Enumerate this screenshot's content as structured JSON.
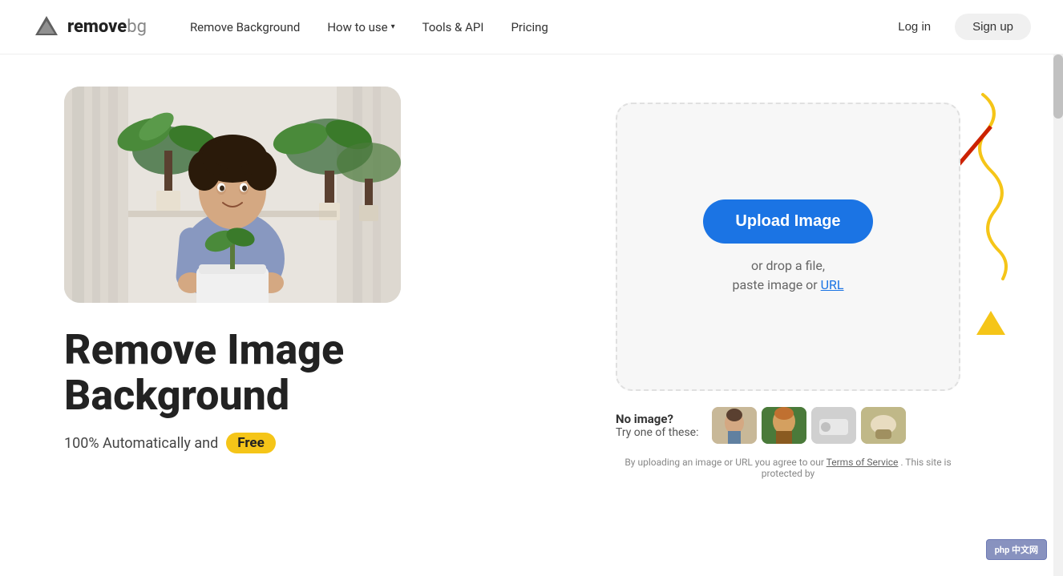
{
  "brand": {
    "logo_text_bold": "remove",
    "logo_text_light": "bg",
    "logo_alt": "remove.bg logo"
  },
  "nav": {
    "remove_bg_label": "Remove Background",
    "how_to_use_label": "How to use",
    "tools_api_label": "Tools & API",
    "pricing_label": "Pricing",
    "login_label": "Log in",
    "signup_label": "Sign up"
  },
  "hero": {
    "title_line1": "Remove Image",
    "title_line2": "Background",
    "subtitle_text": "100% Automatically and",
    "free_badge": "Free"
  },
  "upload": {
    "upload_button_label": "Upload Image",
    "drop_text": "or drop a file,",
    "paste_text": "paste image or",
    "url_link_text": "URL"
  },
  "samples": {
    "no_image_text": "No image?",
    "try_text": "Try one of these:"
  },
  "tos": {
    "text": "By uploading an image or URL you agree to our",
    "tos_link": "Terms of Service",
    "suffix": ". This site is protected by"
  },
  "php_badge": "php 中文网"
}
